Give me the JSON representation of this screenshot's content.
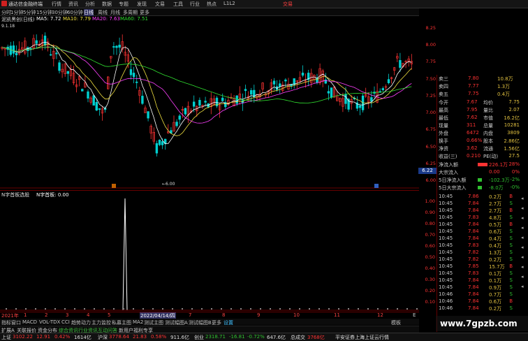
{
  "menubar": {
    "app_title": "通达信金融终端",
    "items": [
      "行情",
      "资讯",
      "分析",
      "数据",
      "专题",
      "发现",
      "文易",
      "工具",
      "行业",
      "热点",
      "L1L2"
    ],
    "right": "交易"
  },
  "periods": [
    "分时",
    "1分钟",
    "5分钟",
    "15分钟",
    "30分钟",
    "60分钟",
    "日线",
    "周线",
    "月线",
    "多周期",
    "更多"
  ],
  "titlebar": {
    "stock": "泥凯黑创(日线)",
    "ma5": "MA5: 7.72",
    "ma10": "MA10: 7.79",
    "ma20": "MA20: 7.63",
    "ma60": "MA60: 7.51",
    "hi_label": "9.1.18"
  },
  "main_scale": [
    "8.25",
    "8.00",
    "7.75",
    "7.50",
    "7.25",
    "7.00",
    "6.75",
    "6.50",
    "6.25",
    "6.00"
  ],
  "main_scale_marker": "6.22",
  "low_label": "6.00",
  "subtitle": {
    "indicator": "N字首板选股",
    "value_label": "N字首板: 0.00"
  },
  "sub_scale": [
    "1.00",
    "0.90",
    "0.80",
    "0.70",
    "0.60",
    "0.50",
    "0.40",
    "0.30",
    "0.20",
    "0.10"
  ],
  "datebar": {
    "items": [
      "2021年",
      "1",
      "2",
      "3",
      "4",
      "5",
      "6",
      "7",
      "8",
      "9",
      "10",
      "11",
      "12"
    ],
    "highlight": "2022/04/14/四",
    "end": "E"
  },
  "tabs": [
    "指标",
    "窗口",
    "MACD",
    "VOL-TDX",
    "CCI",
    "趋势动力",
    "主力监控",
    "私募主图",
    "MA2",
    "测试主图",
    "测试幅图A",
    "测试幅图B",
    "更多",
    "设置"
  ],
  "tabs_right": "模板",
  "links": [
    "扩展A",
    "关联报价",
    "资金分布",
    "综合资讯",
    "行业资讯",
    "互动问答",
    "新用户福利专享"
  ],
  "orderbook": [
    {
      "label": "卖三",
      "price": "7.80",
      "vol": "10.8万"
    },
    {
      "label": "卖四",
      "price": "7.77",
      "vol": "1.3万"
    },
    {
      "label": "卖五",
      "price": "7.75",
      "vol": "0.4万"
    }
  ],
  "quote": [
    {
      "l1": "今开",
      "v1": "7.67",
      "l2": "均价",
      "v2": "7.75"
    },
    {
      "l1": "最高",
      "v1": "7.95",
      "l2": "量比",
      "v2": "2.07"
    },
    {
      "l1": "最低",
      "v1": "7.62",
      "l2": "市值",
      "v2": "16.2亿"
    },
    {
      "l1": "现量",
      "v1": "311",
      "l2": "总量",
      "v2": "10281"
    },
    {
      "l1": "外盘",
      "v1": "6472",
      "l2": "内盘",
      "v2": "3809"
    },
    {
      "l1": "换手",
      "v1": "0.66%",
      "l2": "股本",
      "v2": "2.86亿"
    },
    {
      "l1": "净资",
      "v1": "3.62",
      "l2": "流通",
      "v2": "1.56亿"
    },
    {
      "l1": "收益(三)",
      "v1": "0.210",
      "l2": "PE(动)",
      "v2": "27.5"
    }
  ],
  "flows": [
    {
      "label": "净流入额",
      "value": "226.1万",
      "pct": "28%"
    },
    {
      "label": "大宗流入",
      "value": "0.00",
      "pct": "0%"
    },
    {
      "label": "5日净流入额",
      "value": "-102.3万",
      "pct": "-2%"
    },
    {
      "label": "5日大宗流入",
      "value": "-8.0万",
      "pct": "-0%"
    }
  ],
  "ticks": [
    {
      "t": "10:45",
      "p": "7.86",
      "v": "0.2万",
      "d": "B"
    },
    {
      "t": "10:45",
      "p": "7.84",
      "v": "2.7万",
      "d": "S"
    },
    {
      "t": "10:45",
      "p": "7.84",
      "v": "2.7万",
      "d": "B"
    },
    {
      "t": "10:45",
      "p": "7.83",
      "v": "4.8万",
      "d": "S"
    },
    {
      "t": "10:45",
      "p": "7.84",
      "v": "0.5万",
      "d": "B"
    },
    {
      "t": "10:45",
      "p": "7.84",
      "v": "0.6万",
      "d": "S"
    },
    {
      "t": "10:45",
      "p": "7.84",
      "v": "0.4万",
      "d": "S"
    },
    {
      "t": "10:45",
      "p": "7.83",
      "v": "0.4万",
      "d": "S"
    },
    {
      "t": "10:45",
      "p": "7.82",
      "v": "1.3万",
      "d": "S"
    },
    {
      "t": "10:45",
      "p": "7.82",
      "v": "0.2万",
      "d": "S"
    },
    {
      "t": "10:45",
      "p": "7.85",
      "v": "15.7万",
      "d": "B"
    },
    {
      "t": "10:45",
      "p": "7.83",
      "v": "0.1万",
      "d": "S"
    },
    {
      "t": "10:45",
      "p": "7.84",
      "v": "0.1万",
      "d": "S"
    },
    {
      "t": "10:45",
      "p": "7.84",
      "v": "0.9万",
      "d": "S"
    },
    {
      "t": "10:46",
      "p": "7.84",
      "v": "0.7万",
      "d": "S"
    },
    {
      "t": "10:46",
      "p": "7.84",
      "v": "0.6万",
      "d": "B"
    },
    {
      "t": "10:46",
      "p": "7.84",
      "v": "0.2万",
      "d": "S"
    }
  ],
  "watermark": "www.7gpzb.com",
  "status": [
    {
      "label": "上证",
      "value": "3102.22",
      "chg": "12.91",
      "pct": "0.42%",
      "amt": "1614亿"
    },
    {
      "label": "沪深",
      "value": "3778.64",
      "chg": "21.83",
      "pct": "0.58%",
      "amt": "911.6亿"
    },
    {
      "label": "创业",
      "value": "2318.71",
      "chg": "-16.81",
      "pct": "-0.72%",
      "amt": "647.6亿"
    },
    {
      "label": "总成交",
      "value": "3768亿"
    }
  ],
  "status_right": "平安证券上海上证云行情",
  "colors": {
    "up": "#ff3333",
    "down": "#00d0d0",
    "ma5": "#ffffff",
    "ma10": "#f0e040",
    "ma20": "#ff40ff",
    "ma60": "#30e030"
  }
}
